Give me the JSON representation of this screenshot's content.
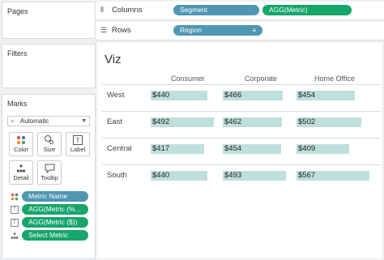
{
  "panels": {
    "pages": "Pages",
    "filters": "Filters",
    "marks": "Marks"
  },
  "marks_card": {
    "mark_type": "Automatic",
    "buttons": [
      "Color",
      "Size",
      "Label",
      "Detail",
      "Tooltip"
    ],
    "pills": [
      "Metric Name",
      "AGG(Metric (%...",
      "AGG(Metric ($))",
      "Select Metric"
    ]
  },
  "shelves": {
    "columns_label": "Columns",
    "rows_label": "Rows",
    "columns_pills": [
      "Segment",
      "AGG(Metric)"
    ],
    "rows_pills": [
      "Region"
    ]
  },
  "viz": {
    "title": "Viz",
    "columns": [
      "Consumer",
      "Corporate",
      "Home Office"
    ],
    "rows": [
      {
        "region": "West",
        "values": [
          "$440",
          "$466",
          "$454"
        ],
        "amounts": [
          440,
          466,
          454
        ]
      },
      {
        "region": "East",
        "values": [
          "$492",
          "$462",
          "$502"
        ],
        "amounts": [
          492,
          462,
          502
        ]
      },
      {
        "region": "Central",
        "values": [
          "$417",
          "$454",
          "$409"
        ],
        "amounts": [
          417,
          454,
          409
        ]
      },
      {
        "region": "South",
        "values": [
          "$440",
          "$493",
          "$567"
        ],
        "amounts": [
          440,
          493,
          567
        ]
      }
    ]
  },
  "colors": {
    "blue_pill": "#4f96b3",
    "green_pill": "#16a56b",
    "bar": "#bfdfdc"
  }
}
